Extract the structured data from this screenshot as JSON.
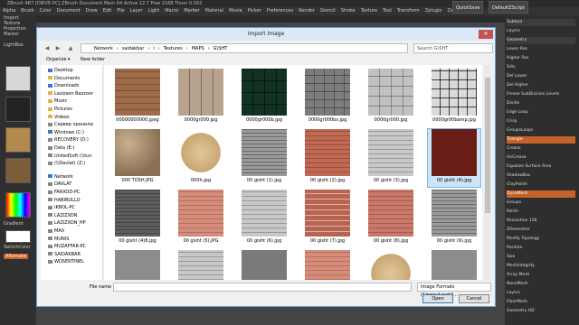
{
  "zbrush": {
    "title": "ZBrush 4R7 [DRIVE-PC] ZBrush Document  Mem 64 Active 12.7 Free 2168 Timer 0.002",
    "menu": [
      "Alpha",
      "Brush",
      "Color",
      "Document",
      "Draw",
      "Edit",
      "File",
      "Layer",
      "Light",
      "Macro",
      "Marker",
      "Material",
      "Movie",
      "Picker",
      "Preferences",
      "Render",
      "Stencil",
      "Stroke",
      "Texture",
      "Tool",
      "Transform",
      "Zplugin",
      "Zscript"
    ],
    "top_buttons": {
      "quicksave": "QuickSave",
      "default": "DefaultZScript"
    },
    "left_labels": {
      "import_texture": "Import Texture",
      "projection_master": "Projection Master",
      "lightbox": "LightBox",
      "gradient": "Gradient",
      "switch_color": "SwitchColor",
      "alternate": "Alternate"
    },
    "right_panel": [
      "Subtool",
      "Layers",
      "Geometry",
      "Lower Res",
      "Higher Res",
      "Sdiv",
      "Del Lower",
      "Del Higher",
      "Freeze SubDivision Levels",
      "Divide",
      "Edge Loop",
      "Crisp",
      "GroupsLoops",
      "Triangle",
      "Crease",
      "UnCrease",
      "Equalize Surface Area",
      "ShadowBox",
      "ClayPolish",
      "DynaMesh",
      "Groups",
      "Polish",
      "Resolution 128",
      "ZRemesher",
      "Modify Topology",
      "Position",
      "Size",
      "MeshIntegrity",
      "Array Mesh",
      "NanoMesh",
      "Layers",
      "FiberMesh",
      "Geometry HD"
    ]
  },
  "dialog": {
    "title": "Import Image",
    "close": "✕",
    "breadcrumb": [
      "Network",
      "saidakbar",
      "i",
      "Textures",
      "MAPS",
      "G\\SHT"
    ],
    "search_placeholder": "Search G\\SHT",
    "organize": "Organize ▾",
    "new_folder": "New folder",
    "nav": [
      {
        "label": "Desktop",
        "color": "#3a78c3"
      },
      {
        "label": "Documents",
        "color": "#e2b34a"
      },
      {
        "label": "Downloads",
        "color": "#3a78c3"
      },
      {
        "label": "Lazizxon Bazzoor",
        "color": "#e2b34a"
      },
      {
        "label": "Music",
        "color": "#e2b34a"
      },
      {
        "label": "Pictures",
        "color": "#e2b34a"
      },
      {
        "label": "Videos",
        "color": "#e2b34a"
      },
      {
        "label": "Сервер хранили",
        "color": "#888888"
      },
      {
        "label": "Windows (C:)",
        "color": "#3a78c3"
      },
      {
        "label": "RECOVERY (D:)",
        "color": "#888888"
      },
      {
        "label": "Data (E:)",
        "color": "#888888"
      },
      {
        "label": "UnitedSoft (\\\\tun",
        "color": "#888888"
      },
      {
        "label": "(\\\\Davlat) (Z:)",
        "color": "#888888"
      },
      {
        "label": "Network",
        "color": "#3a78c3"
      },
      {
        "label": "DAVLAT",
        "color": "#888888"
      },
      {
        "label": "FARXOD-PC",
        "color": "#888888"
      },
      {
        "label": "HABIBULLO",
        "color": "#888888"
      },
      {
        "label": "IKBOL-PC",
        "color": "#888888"
      },
      {
        "label": "LAZIZXON",
        "color": "#888888"
      },
      {
        "label": "LAZIZXON_HP",
        "color": "#888888"
      },
      {
        "label": "MAX",
        "color": "#888888"
      },
      {
        "label": "MUNIS",
        "color": "#888888"
      },
      {
        "label": "MUZAFFAR-PC",
        "color": "#888888"
      },
      {
        "label": "SAIDAKBAR",
        "color": "#888888"
      },
      {
        "label": "WDSENTINEL",
        "color": "#888888"
      }
    ],
    "files": [
      {
        "name": "00000000000.jpeg",
        "tex": "t-stone1"
      },
      {
        "name": "0000gr000.jpg",
        "tex": "t-stone2"
      },
      {
        "name": "0000gr000b.jpg",
        "tex": "t-green"
      },
      {
        "name": "0000gr000bs.jpg",
        "tex": "t-grey1"
      },
      {
        "name": "0000gr000.jpg",
        "tex": "t-lightgrey"
      },
      {
        "name": "0000gr00bamp.jpg",
        "tex": "t-bw"
      },
      {
        "name": "000 TOSH.JPG",
        "tex": "t-rock"
      },
      {
        "name": "000h.jpg",
        "tex": "t-sand"
      },
      {
        "name": "00 gisht (1).jpg",
        "tex": "t-greybrick"
      },
      {
        "name": "00 gisht (2).jpg",
        "tex": "t-redbrick"
      },
      {
        "name": "00 gisht (3).jpg",
        "tex": "t-lightbrick"
      },
      {
        "name": "00 gisht (4).jpg",
        "tex": "t-darkred"
      },
      {
        "name": "00 gisht (4)8.jpg",
        "tex": "t-darkgrey"
      },
      {
        "name": "00 gisht (5).JPG",
        "tex": "t-lightred"
      },
      {
        "name": "00 gisht (6).jpg",
        "tex": "t-lightbrick"
      },
      {
        "name": "00 gisht (7).jpg",
        "tex": "t-redbrick2"
      },
      {
        "name": "00 gisht (8).jpg",
        "tex": "t-pinkbrick"
      },
      {
        "name": "00 gisht (9).jpg",
        "tex": "t-greybrick"
      },
      {
        "name": "",
        "tex": "t-grey2"
      },
      {
        "name": "",
        "tex": "t-lightbrick"
      },
      {
        "name": "",
        "tex": "t-grey3"
      },
      {
        "name": "",
        "tex": "t-lightred"
      },
      {
        "name": "",
        "tex": "t-sand"
      },
      {
        "name": "",
        "tex": "t-grey2"
      }
    ],
    "selected_index": 11,
    "file_name_label": "File name",
    "file_name_value": "",
    "filter": "Image Formats (*.bmp;*.psd;*...",
    "open": "Open",
    "cancel": "Cancel"
  }
}
